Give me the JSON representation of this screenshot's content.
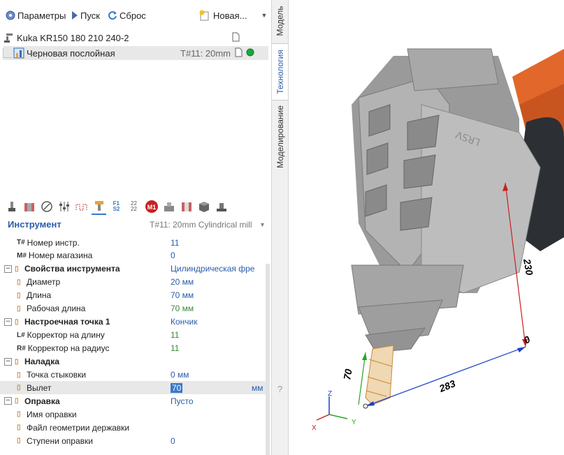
{
  "toolbar": {
    "params_label": "Параметры",
    "run_label": "Пуск",
    "reset_label": "Сброс",
    "new_label": "Новая..."
  },
  "tree": {
    "robot_label": "Kuka KR150 180 210 240-2",
    "operation_label": "Черновая послойная",
    "operation_tool": "T#11: 20mm"
  },
  "tool_header": {
    "title": "Инструмент",
    "tool_select": "T#11: 20mm Cylindrical mill"
  },
  "properties": [
    {
      "id": "tool-number",
      "icon": "T#",
      "label": "Номер инстр.",
      "value": "11",
      "color": "blue",
      "indent": 1
    },
    {
      "id": "magazine-number",
      "icon": "M#",
      "label": "Номер магазина",
      "value": "0",
      "color": "blue",
      "indent": 1
    },
    {
      "id": "tool-properties",
      "group": true,
      "label": "Свойства инструмента",
      "value": "Цилиндрическая фре",
      "color": "blue"
    },
    {
      "id": "diameter",
      "label": "Диаметр",
      "value": "20 мм",
      "color": "blue",
      "indent": 1
    },
    {
      "id": "length",
      "label": "Длина",
      "value": "70 мм",
      "color": "blue",
      "indent": 1
    },
    {
      "id": "working-length",
      "label": "Рабочая длина",
      "value": "70 мм",
      "color": "green",
      "indent": 1
    },
    {
      "id": "setup-point",
      "group": true,
      "label": "Настроечная точка 1",
      "value": "Кончик",
      "color": "blue"
    },
    {
      "id": "length-corrector",
      "icon": "L#",
      "label": "Корректор на длину",
      "value": "11",
      "color": "green",
      "indent": 1
    },
    {
      "id": "radius-corrector",
      "icon": "R#",
      "label": "Корректор на радиус",
      "value": "11",
      "color": "green",
      "indent": 1
    },
    {
      "id": "setup",
      "group": true,
      "label": "Наладка",
      "value": "",
      "color": "blue"
    },
    {
      "id": "dock-point",
      "label": "Точка стыковки",
      "value": "0 мм",
      "color": "blue",
      "indent": 1
    },
    {
      "id": "overhang",
      "label": "Вылет",
      "value": "70",
      "unit": "мм",
      "color": "blue",
      "indent": 1,
      "editing": true
    },
    {
      "id": "holder",
      "group": true,
      "label": "Оправка",
      "value": "Пусто",
      "color": "blue"
    },
    {
      "id": "holder-name",
      "label": "Имя оправки",
      "value": "",
      "color": "blue",
      "indent": 1
    },
    {
      "id": "holder-geometry",
      "label": "Файл геометрии державки",
      "value": "",
      "color": "blue",
      "indent": 1
    },
    {
      "id": "holder-steps",
      "label": "Ступени оправки",
      "value": "0",
      "color": "blue",
      "indent": 1
    }
  ],
  "side_tabs": {
    "model": "Модель",
    "technology": "Технология",
    "modeling": "Моделирование",
    "help": "?"
  },
  "viewport": {
    "dim_height": "230",
    "dim_length": "283",
    "dim_tool": "70",
    "dim_zero": "0",
    "housing_text": "LRSV",
    "axis_x": "X",
    "axis_y": "Y",
    "axis_z": "Z"
  },
  "colors": {
    "accent_blue": "#2a5caa",
    "green_value": "#3a8a3a",
    "selection_bg": "#e8e8e8",
    "edit_highlight": "#3a78c8",
    "robot_orange": "#e2672a"
  }
}
